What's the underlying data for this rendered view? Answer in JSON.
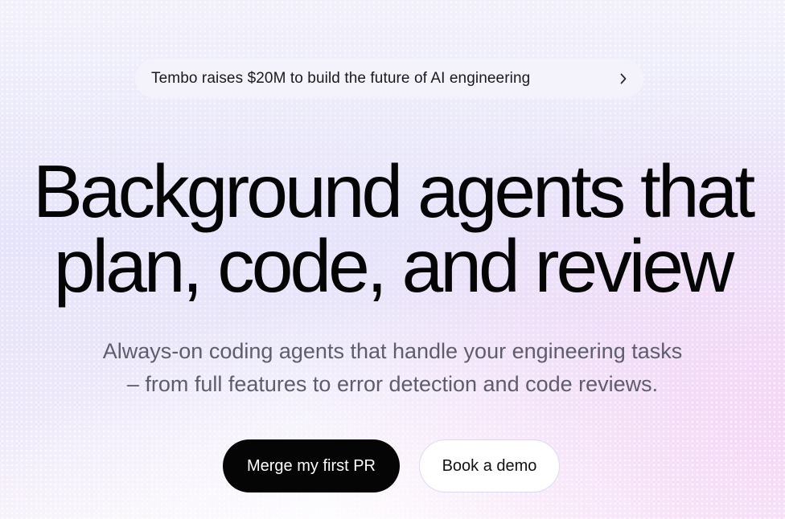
{
  "announcement": {
    "text": "Tembo raises $20M to build the future of AI engineering",
    "icon": "chevron-right-icon"
  },
  "hero": {
    "headline_line1": "Background agents that",
    "headline_line2": "plan, code, and review",
    "subtitle_line1": "Always-on coding agents that handle your engineering tasks",
    "subtitle_line2": "– from full features to error detection and code reviews."
  },
  "actions": {
    "primary_label": "Merge my first PR",
    "secondary_label": "Book a demo"
  },
  "colors": {
    "text_primary": "#050505",
    "text_secondary": "#5d5d6b",
    "background": "#ecebfb",
    "accent_pink": "#f6d6f6",
    "button_primary_bg": "#050505",
    "button_secondary_bg": "#ffffff"
  }
}
